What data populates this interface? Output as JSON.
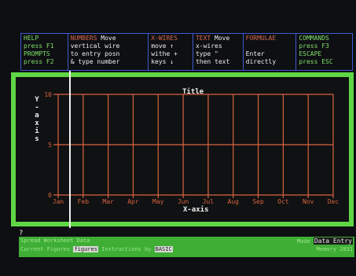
{
  "help": [
    {
      "head": "HELP",
      "line1": "press F1",
      "line2": "PROMPTS",
      "line3": "press F2"
    },
    {
      "head": "NUMBERS",
      "head_tail": "Move",
      "line1": "vertical wire",
      "line2": "to entry posn",
      "line3": "& type number"
    },
    {
      "head": "X-WIRES",
      "line1": "move ↑",
      "line2": "withe +",
      "line3": "keys ↓"
    },
    {
      "head": "TEXT",
      "head_tail": "Move",
      "line1": "x-wires",
      "line2": "type \"",
      "line3": "then text"
    },
    {
      "head": "FORMULAE",
      "line1": "",
      "line2": "Enter",
      "line3": "directly"
    },
    {
      "head": "COMMANDS",
      "line1": "press F3",
      "line2": "ESCAPE",
      "line3": "press ESC"
    }
  ],
  "chart_data": {
    "type": "line",
    "title": "Title",
    "xlabel": "X-axis",
    "ylabel": "Y-axis",
    "categories": [
      "Jan",
      "Feb",
      "Mar",
      "Apr",
      "May",
      "Jun",
      "Jul",
      "Aug",
      "Sep",
      "Oct",
      "Nov",
      "Dec"
    ],
    "yticks": [
      "0",
      "5",
      "10"
    ],
    "ylim": [
      0,
      10
    ],
    "grid": true,
    "series": []
  },
  "prompt": "?",
  "status": {
    "line1": "Spread  Worksheet  Data",
    "line2_prefix": "Current  Figures",
    "line2_highlight": "figures",
    "line2_mid": "Instructions by",
    "line2_tag": "BASIC",
    "right1_prefix": "Mode",
    "mode": "Data Entry",
    "right2": "Memory  2831"
  },
  "colors": {
    "frame": "#5fd645",
    "grid": "#d9643f",
    "help_border": "#3d5bd0",
    "status_bg": "#3fae35"
  }
}
